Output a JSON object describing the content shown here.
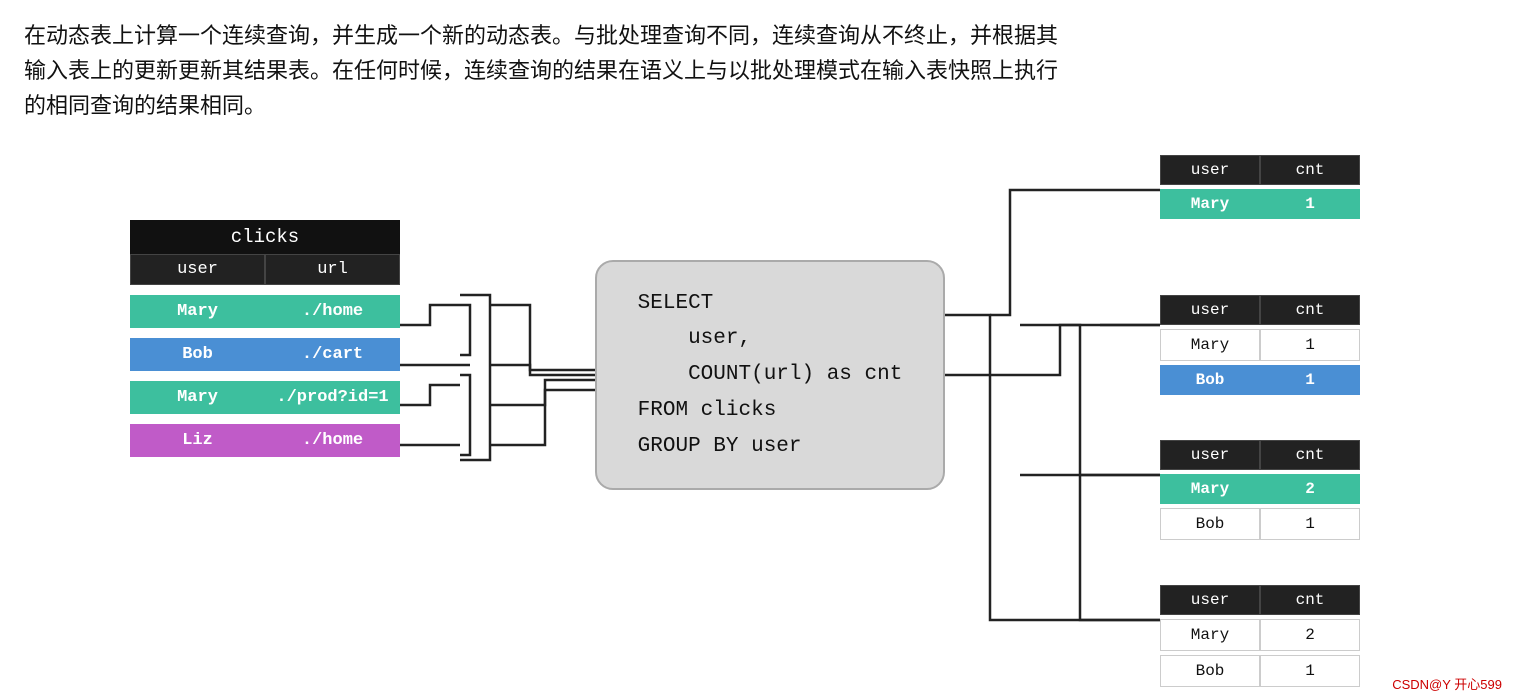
{
  "header": {
    "text_line1": "在动态表上计算一个连续查询，并生成一个新的动态表。与批处理查询不同，连续查询从不终止，并根据其",
    "text_line2": "输入表上的更新更新其结果表。在任何时候，连续查询的结果在语义上与以批处理模式在输入表快照上执行",
    "text_line3": "的相同查询的结果相同。"
  },
  "clicks_table": {
    "title": "clicks",
    "headers": [
      "user",
      "url"
    ],
    "rows": [
      {
        "user": "Mary",
        "url": "./home",
        "color": "green"
      },
      {
        "user": "Bob",
        "url": "./cart",
        "color": "blue"
      },
      {
        "user": "Mary",
        "url": "./prod?id=1",
        "color": "green"
      },
      {
        "user": "Liz",
        "url": "./home",
        "color": "purple"
      }
    ]
  },
  "sql": {
    "code": "SELECT\n    user,\n    COUNT(url) as cnt\nFROM clicks\nGROUP BY user"
  },
  "result_tables": [
    {
      "id": "rt1",
      "headers": [
        "user",
        "cnt"
      ],
      "rows": [
        {
          "user": "Mary",
          "cnt": "1",
          "user_color": "green",
          "cnt_color": "green"
        }
      ]
    },
    {
      "id": "rt2",
      "headers": [
        "user",
        "cnt"
      ],
      "rows": [
        {
          "user": "Mary",
          "cnt": "1",
          "user_color": "white",
          "cnt_color": "white"
        },
        {
          "user": "Bob",
          "cnt": "1",
          "user_color": "blue",
          "cnt_color": "blue"
        }
      ]
    },
    {
      "id": "rt3",
      "headers": [
        "user",
        "cnt"
      ],
      "rows": [
        {
          "user": "Mary",
          "cnt": "2",
          "user_color": "green",
          "cnt_color": "green"
        },
        {
          "user": "Bob",
          "cnt": "1",
          "user_color": "white",
          "cnt_color": "white"
        }
      ]
    },
    {
      "id": "rt4",
      "headers": [
        "user",
        "cnt"
      ],
      "rows": [
        {
          "user": "Mary",
          "cnt": "2",
          "user_color": "white",
          "cnt_color": "white"
        },
        {
          "user": "Bob",
          "cnt": "1",
          "user_color": "white",
          "cnt_color": "white"
        }
      ]
    }
  ],
  "watermark": "CSDN@Y 开心599"
}
